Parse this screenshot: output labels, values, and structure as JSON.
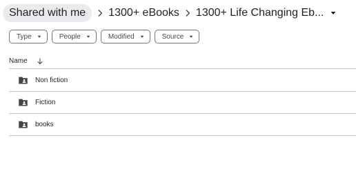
{
  "breadcrumb": {
    "root": "Shared with me",
    "middle": "1300+ eBooks",
    "current": "1300+ Life Changing Eb..."
  },
  "filters": [
    {
      "label": "Type"
    },
    {
      "label": "People"
    },
    {
      "label": "Modified"
    },
    {
      "label": "Source"
    }
  ],
  "table": {
    "name_header": "Name",
    "rows": [
      {
        "name": "Non fiction",
        "icon": "shared-folder-icon"
      },
      {
        "name": "Fiction",
        "icon": "shared-folder-icon"
      },
      {
        "name": "books",
        "icon": "shared-folder-icon"
      }
    ]
  },
  "colors": {
    "pill_bg": "#e9ebee",
    "text": "#1f1f1f",
    "divider": "#c7c7c7",
    "chip_border": "#747775"
  }
}
